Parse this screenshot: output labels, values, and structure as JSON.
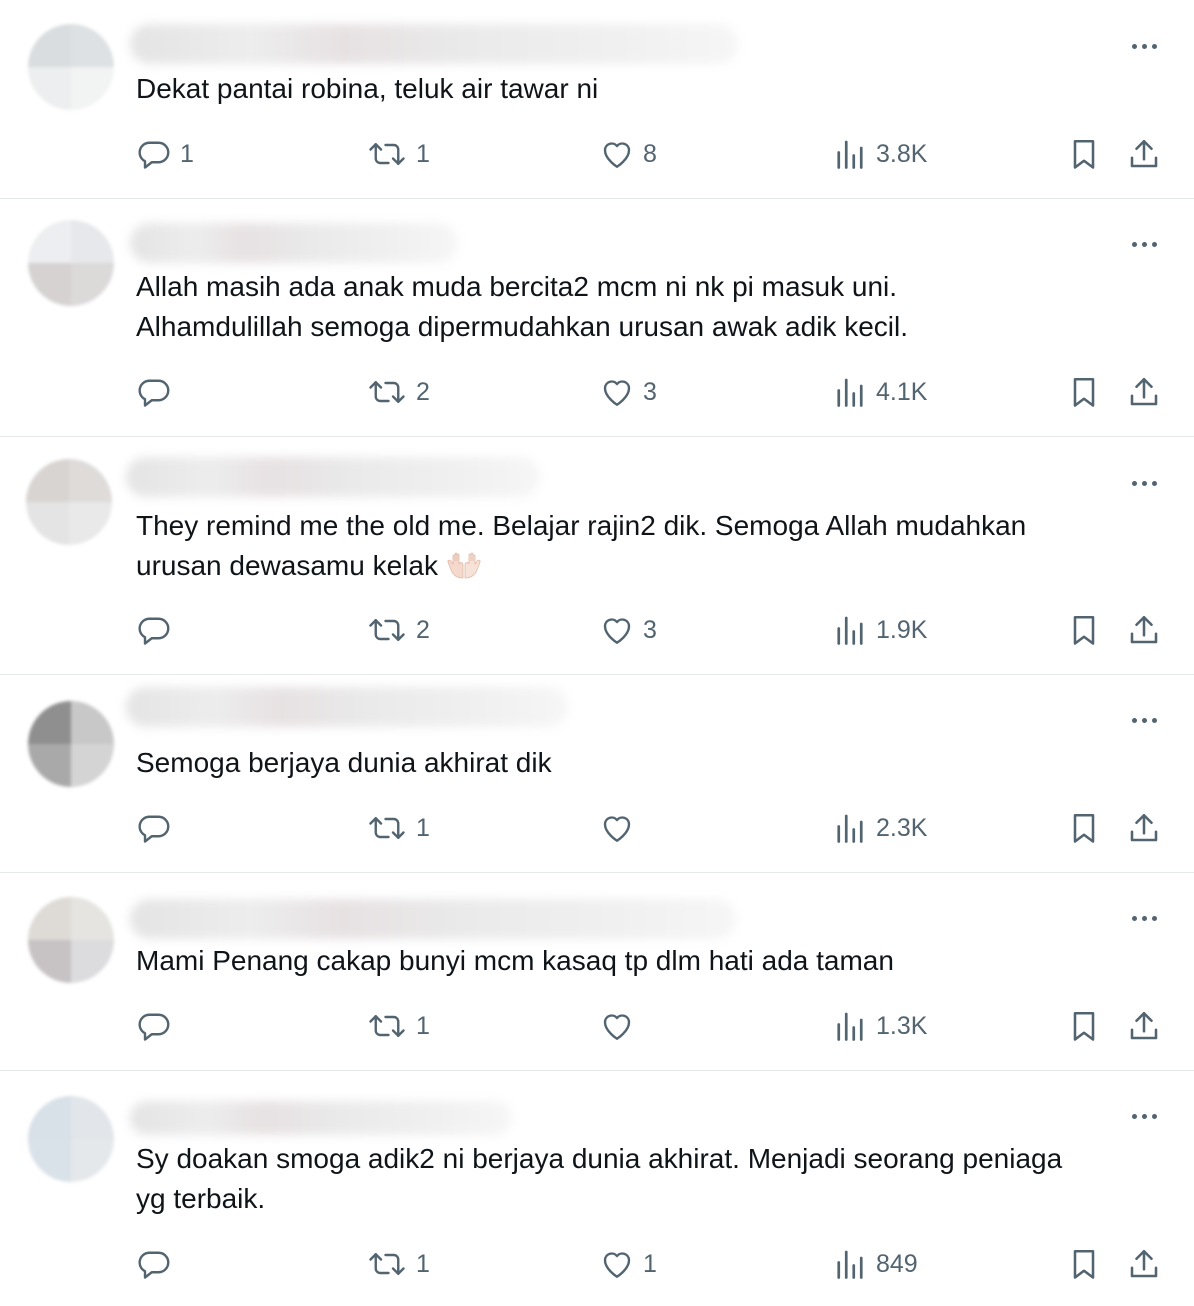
{
  "posts": [
    {
      "text": "Dekat pantai robina, teluk air tawar ni",
      "replies": "1",
      "reposts": "1",
      "likes": "8",
      "views": "3.8K"
    },
    {
      "text": "Allah masih ada anak muda bercita2 mcm ni nk pi masuk uni.\nAlhamdulillah semoga dipermudahkan urusan awak adik kecil.",
      "replies": "",
      "reposts": "2",
      "likes": "3",
      "views": "4.1K"
    },
    {
      "text": "They remind me the old me. Belajar rajin2 dik. Semoga Allah mudahkan\nurusan dewasamu kelak",
      "emoji": "palms-up-together-icon",
      "replies": "",
      "reposts": "2",
      "likes": "3",
      "views": "1.9K"
    },
    {
      "text": "Semoga berjaya dunia akhirat dik",
      "replies": "",
      "reposts": "1",
      "likes": "",
      "views": "2.3K"
    },
    {
      "text": "Mami Penang cakap bunyi mcm kasaq tp dlm hati ada taman",
      "replies": "",
      "reposts": "1",
      "likes": "",
      "views": "1.3K"
    },
    {
      "text": "Sy doakan smoga adik2 ni berjaya dunia akhirat. Menjadi seorang peniaga\nyg terbaik.",
      "replies": "",
      "reposts": "1",
      "likes": "1",
      "views": "849"
    }
  ],
  "icons": {
    "reply": "reply-icon",
    "repost": "repost-icon",
    "like": "heart-icon",
    "views": "views-icon",
    "bookmark": "bookmark-icon",
    "share": "share-icon",
    "more": "more-icon"
  },
  "colors": {
    "text": "#0f1419",
    "secondary": "#536471",
    "divider": "#e6e9ec"
  }
}
